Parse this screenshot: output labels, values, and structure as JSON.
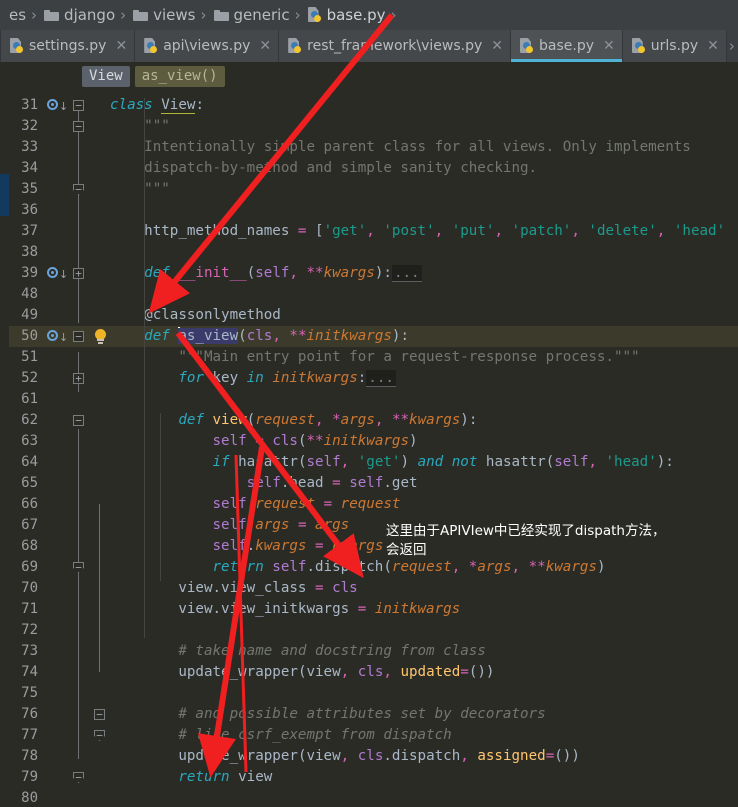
{
  "breadcrumb": {
    "items": [
      {
        "label": "es",
        "icon": "none"
      },
      {
        "label": "django",
        "icon": "folder-icon"
      },
      {
        "label": "views",
        "icon": "folder-icon"
      },
      {
        "label": "generic",
        "icon": "folder-icon"
      },
      {
        "label": "base.py",
        "icon": "python-file-icon"
      }
    ],
    "separator": "›"
  },
  "tabs": {
    "items": [
      {
        "label": "settings.py",
        "icon": "python-file-icon",
        "close": "✕",
        "active": false
      },
      {
        "label": "api\\views.py",
        "icon": "python-file-icon",
        "close": "✕",
        "active": false
      },
      {
        "label": "rest_framework\\views.py",
        "icon": "python-file-icon",
        "close": "✕",
        "active": false
      },
      {
        "label": "base.py",
        "icon": "python-file-icon",
        "close": "✕",
        "active": true
      },
      {
        "label": "urls.py",
        "icon": "python-file-icon",
        "close": "✕",
        "active": false
      }
    ],
    "overflow": "›",
    "active_underline_color": "#4eb3d4"
  },
  "structure_bar": {
    "class_chip": "View",
    "function_chip": "as_view()"
  },
  "editor": {
    "language": "python",
    "file": "base.py",
    "highlighted_line": 50,
    "caret_line": 50,
    "selected_token": "as_view",
    "background": "#2b2b26",
    "lines": [
      {
        "no": "31",
        "text": "class View:"
      },
      {
        "no": "32",
        "text": "    \"\"\""
      },
      {
        "no": "33",
        "text": "    Intentionally simple parent class for all views. Only implements"
      },
      {
        "no": "34",
        "text": "    dispatch-by-method and simple sanity checking."
      },
      {
        "no": "35",
        "text": "    \"\"\""
      },
      {
        "no": "36",
        "text": ""
      },
      {
        "no": "37",
        "text": "    http_method_names = ['get', 'post', 'put', 'patch', 'delete', 'head'"
      },
      {
        "no": "38",
        "text": ""
      },
      {
        "no": "39",
        "text": "    def __init__(self, **kwargs):..."
      },
      {
        "no": "48",
        "text": ""
      },
      {
        "no": "49",
        "text": "    @classonlymethod"
      },
      {
        "no": "50",
        "text": "    def as_view(cls, **initkwargs):"
      },
      {
        "no": "51",
        "text": "        \"\"\"Main entry point for a request-response process.\"\"\""
      },
      {
        "no": "52",
        "text": "        for key in initkwargs:..."
      },
      {
        "no": "61",
        "text": ""
      },
      {
        "no": "62",
        "text": "        def view(request, *args, **kwargs):"
      },
      {
        "no": "63",
        "text": "            self = cls(**initkwargs)"
      },
      {
        "no": "64",
        "text": "            if hasattr(self, 'get') and not hasattr(self, 'head'):"
      },
      {
        "no": "65",
        "text": "                self.head = self.get"
      },
      {
        "no": "66",
        "text": "            self.request = request"
      },
      {
        "no": "67",
        "text": "            self.args = args"
      },
      {
        "no": "68",
        "text": "            self.kwargs = kwargs"
      },
      {
        "no": "69",
        "text": "            return self.dispatch(request, *args, **kwargs)"
      },
      {
        "no": "70",
        "text": "        view.view_class = cls"
      },
      {
        "no": "71",
        "text": "        view.view_initkwargs = initkwargs"
      },
      {
        "no": "72",
        "text": ""
      },
      {
        "no": "73",
        "text": "        # take name and docstring from class"
      },
      {
        "no": "74",
        "text": "        update_wrapper(view, cls, updated=())"
      },
      {
        "no": "75",
        "text": ""
      },
      {
        "no": "76",
        "text": "        # and possible attributes set by decorators"
      },
      {
        "no": "77",
        "text": "        # like csrf_exempt from dispatch"
      },
      {
        "no": "78",
        "text": "        update_wrapper(view, cls.dispatch, assigned=())"
      },
      {
        "no": "79",
        "text": "        return view"
      },
      {
        "no": "80",
        "text": ""
      }
    ]
  },
  "annotations": {
    "note_text": "这里由于APIVIew中已经实现了dispath方法，\n会返回",
    "arrow_color": "#f02020",
    "arrow_count": 3
  }
}
